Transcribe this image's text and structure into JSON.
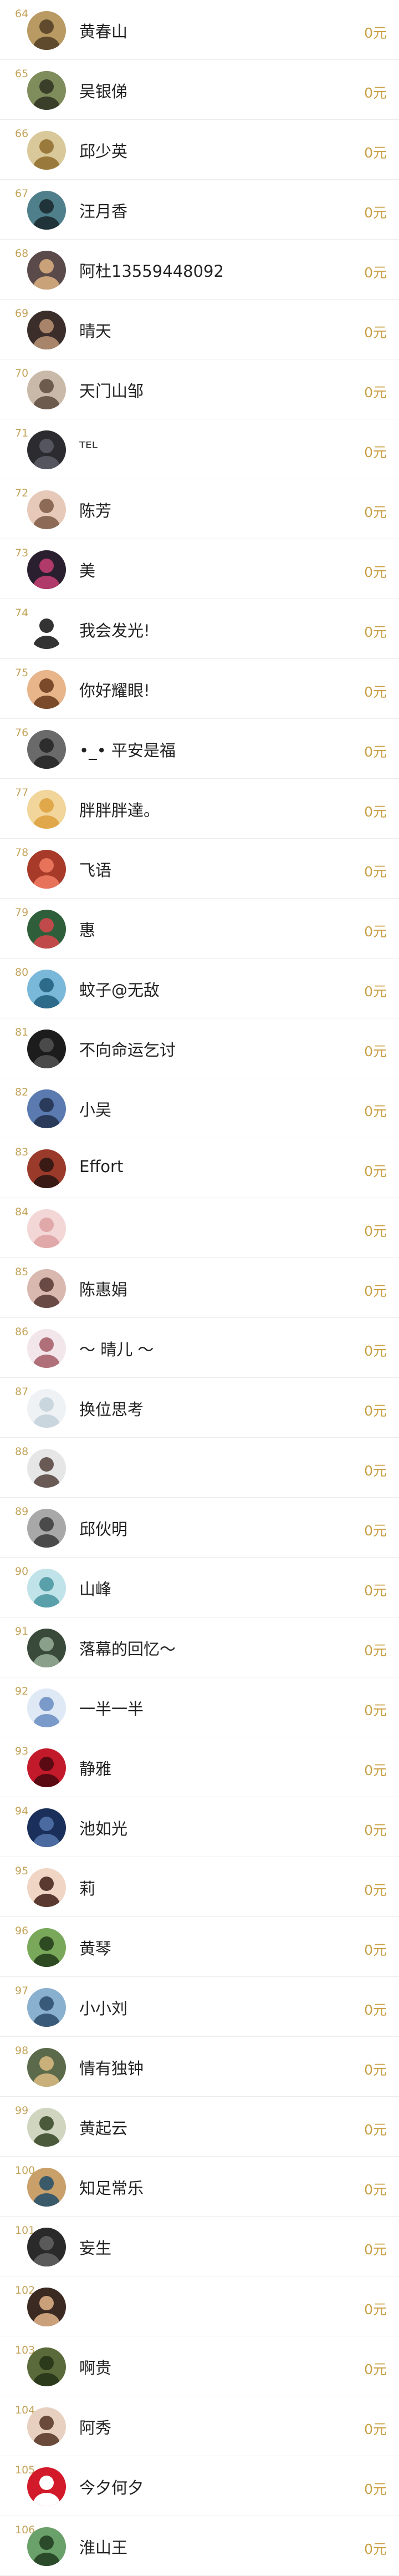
{
  "ranking": {
    "currency_unit": "元",
    "rows": [
      {
        "rank": "64",
        "name": "黄春山",
        "amount": "0元",
        "avatar_palette": [
          "#b89a62",
          "#5f4a2d"
        ]
      },
      {
        "rank": "65",
        "name": "吴银俤",
        "amount": "0元",
        "avatar_palette": [
          "#7f8d5c",
          "#3a3f2a"
        ]
      },
      {
        "rank": "66",
        "name": "邱少英",
        "amount": "0元",
        "avatar_palette": [
          "#d9c89a",
          "#9a7a3c"
        ]
      },
      {
        "rank": "67",
        "name": "汪月香",
        "amount": "0元",
        "avatar_palette": [
          "#4f7f8a",
          "#1f3338"
        ]
      },
      {
        "rank": "68",
        "name": "阿杜13559448092",
        "amount": "0元",
        "avatar_palette": [
          "#5a4a4a",
          "#c9a27a"
        ]
      },
      {
        "rank": "69",
        "name": "晴天",
        "amount": "0元",
        "avatar_palette": [
          "#3b2e2a",
          "#a8856a"
        ]
      },
      {
        "rank": "70",
        "name": "天门山邹",
        "amount": "0元",
        "avatar_palette": [
          "#c9b9a8",
          "#6d5b4d"
        ]
      },
      {
        "rank": "71",
        "name": "ᵀᴱᴸ",
        "amount": "0元",
        "avatar_palette": [
          "#2b2b30",
          "#55555f"
        ]
      },
      {
        "rank": "72",
        "name": "陈芳",
        "amount": "0元",
        "avatar_palette": [
          "#e6c9b8",
          "#8c6a55"
        ]
      },
      {
        "rank": "73",
        "name": "美",
        "amount": "0元",
        "avatar_palette": [
          "#2a1f2e",
          "#b03a6a"
        ]
      },
      {
        "rank": "74",
        "name": "我会发光!",
        "amount": "0元",
        "avatar_palette": [
          "#ffffff",
          "#333333"
        ]
      },
      {
        "rank": "75",
        "name": "你好耀眼!",
        "amount": "0元",
        "avatar_palette": [
          "#e8b48a",
          "#7a4a2a"
        ]
      },
      {
        "rank": "76",
        "name": "•_•  平安是福",
        "amount": "0元",
        "avatar_palette": [
          "#6a6a6a",
          "#2d2d2d"
        ]
      },
      {
        "rank": "77",
        "name": "胖胖胖達。",
        "amount": "0元",
        "avatar_palette": [
          "#f1d59a",
          "#e0a84a"
        ]
      },
      {
        "rank": "78",
        "name": "飞语",
        "amount": "0元",
        "avatar_palette": [
          "#a83a2a",
          "#e6735a"
        ]
      },
      {
        "rank": "79",
        "name": "惠",
        "amount": "0元",
        "avatar_palette": [
          "#2e5f3a",
          "#c04a4a"
        ]
      },
      {
        "rank": "80",
        "name": "蚊子@无敌",
        "amount": "0元",
        "avatar_palette": [
          "#7ab8d9",
          "#2e6a8a"
        ]
      },
      {
        "rank": "81",
        "name": "不向命运乞讨",
        "amount": "0元",
        "avatar_palette": [
          "#1c1c1c",
          "#4a4a4a"
        ]
      },
      {
        "rank": "82",
        "name": "小吴",
        "amount": "0元",
        "avatar_palette": [
          "#5a7ab0",
          "#2a3a5a"
        ]
      },
      {
        "rank": "83",
        "name": "Effort",
        "amount": "0元",
        "avatar_palette": [
          "#9a3a2a",
          "#3a1a15"
        ]
      },
      {
        "rank": "84",
        "name": "",
        "amount": "0元",
        "avatar_palette": [
          "#f3d6d6",
          "#e0a8a8"
        ]
      },
      {
        "rank": "85",
        "name": "陈惠娟",
        "amount": "0元",
        "avatar_palette": [
          "#d9b8b0",
          "#6a4a45"
        ]
      },
      {
        "rank": "86",
        "name": "～ 晴儿 ～",
        "amount": "0元",
        "avatar_palette": [
          "#f2e6ea",
          "#b0707a"
        ]
      },
      {
        "rank": "87",
        "name": "换位思考",
        "amount": "0元",
        "avatar_palette": [
          "#eef2f5",
          "#c9d6de"
        ]
      },
      {
        "rank": "88",
        "name": "",
        "amount": "0元",
        "avatar_palette": [
          "#e6e6e6",
          "#6a5a55"
        ]
      },
      {
        "rank": "89",
        "name": "邱伙明",
        "amount": "0元",
        "avatar_palette": [
          "#a8a8a8",
          "#4a4a4a"
        ]
      },
      {
        "rank": "90",
        "name": "山峰",
        "amount": "0元",
        "avatar_palette": [
          "#bfe3e8",
          "#5aa0aa"
        ]
      },
      {
        "rank": "91",
        "name": "落幕的回忆～",
        "amount": "0元",
        "avatar_palette": [
          "#3a4a3a",
          "#8aa08a"
        ]
      },
      {
        "rank": "92",
        "name": "一半一半",
        "amount": "0元",
        "avatar_palette": [
          "#dfe9f5",
          "#7a9ac9"
        ]
      },
      {
        "rank": "93",
        "name": "静雅",
        "amount": "0元",
        "avatar_palette": [
          "#c21a2a",
          "#5a0a12"
        ]
      },
      {
        "rank": "94",
        "name": "池如光",
        "amount": "0元",
        "avatar_palette": [
          "#1a2f5a",
          "#4a6aa0"
        ]
      },
      {
        "rank": "95",
        "name": "莉",
        "amount": "0元",
        "avatar_palette": [
          "#f0d5c5",
          "#5a3a30"
        ]
      },
      {
        "rank": "96",
        "name": "黄琴",
        "amount": "0元",
        "avatar_palette": [
          "#7aa85a",
          "#2e4a22"
        ]
      },
      {
        "rank": "97",
        "name": "小小刘",
        "amount": "0元",
        "avatar_palette": [
          "#8ab0d0",
          "#3a5a7a"
        ]
      },
      {
        "rank": "98",
        "name": "情有独钟",
        "amount": "0元",
        "avatar_palette": [
          "#5a6a4a",
          "#c9b07a"
        ]
      },
      {
        "rank": "99",
        "name": "黄起云",
        "amount": "0元",
        "avatar_palette": [
          "#d0d5c0",
          "#4a5a3a"
        ]
      },
      {
        "rank": "100",
        "name": "知足常乐",
        "amount": "0元",
        "avatar_palette": [
          "#c9a06a",
          "#3a5a6a"
        ]
      },
      {
        "rank": "101",
        "name": "妄生",
        "amount": "0元",
        "avatar_palette": [
          "#2a2a2a",
          "#5a5a5a"
        ]
      },
      {
        "rank": "102",
        "name": "",
        "amount": "0元",
        "avatar_palette": [
          "#3a2a22",
          "#c9a07a"
        ]
      },
      {
        "rank": "103",
        "name": "啊贵",
        "amount": "0元",
        "avatar_palette": [
          "#5a6a3a",
          "#2a3a1a"
        ]
      },
      {
        "rank": "104",
        "name": "阿秀",
        "amount": "0元",
        "avatar_palette": [
          "#e8d0c0",
          "#6a4a3a"
        ]
      },
      {
        "rank": "105",
        "name": "今夕何夕",
        "amount": "0元",
        "avatar_palette": [
          "#d21a2a",
          "#ffffff"
        ]
      },
      {
        "rank": "106",
        "name": "淮山王",
        "amount": "0元",
        "avatar_palette": [
          "#6aa06a",
          "#2a4a2a"
        ]
      }
    ]
  }
}
